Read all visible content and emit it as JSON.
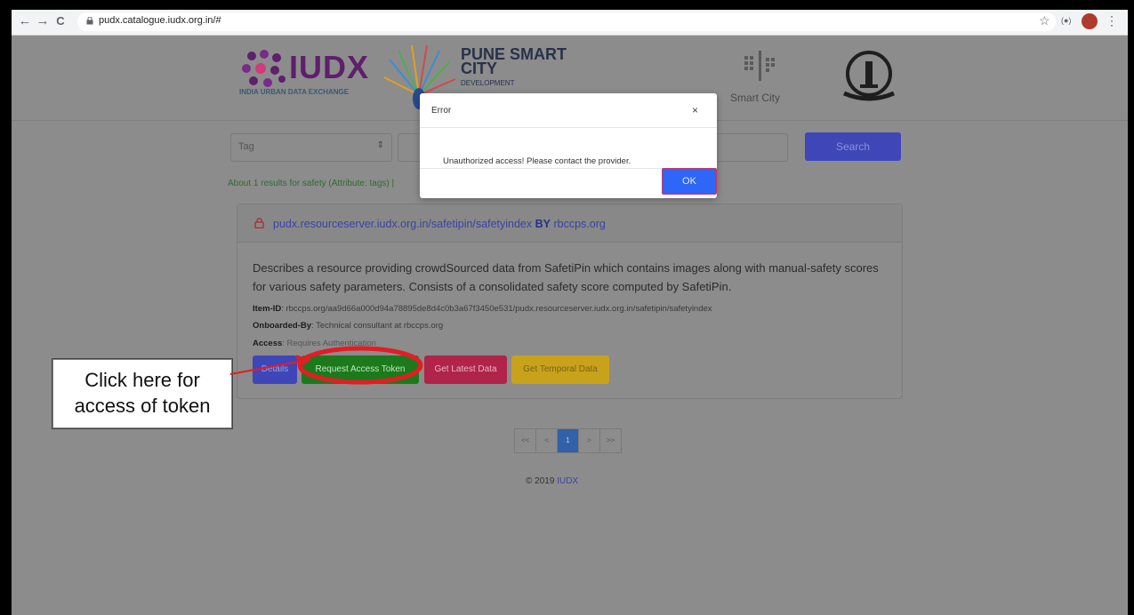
{
  "browser": {
    "url": "pudx.catalogue.iudx.org.in/#",
    "back_glyph": "←",
    "forward_glyph": "→",
    "reload_glyph": "C",
    "star_glyph": "☆",
    "ext_label": "(●)",
    "menu_glyph": "⋮"
  },
  "logos": {
    "iudx": "IUDX",
    "iudx_sub": "INDIA URBAN DATA EXCHANGE",
    "pune_title": "PUNE SMART CITY",
    "pune_sub": "DEVELOPMENT",
    "smart_city": "Smart City"
  },
  "search": {
    "tag_label": "Tag",
    "select_arrow": "⇕",
    "button": "Search"
  },
  "results_text": "About 1 results for safety (Attribute: tags) |",
  "card": {
    "title_url": "pudx.resourceserver.iudx.org.in/safetipin/safetyindex",
    "title_by": "BY",
    "title_provider": "rbccps.org",
    "description": "Describes a resource providing crowdSourced data from SafetiPin which contains images along with manual-safety scores for various safety parameters. Consists of a consolidated safety score computed by SafetiPin.",
    "item_id_label": "Item-ID",
    "item_id_value": ": rbccps.org/aa9d66a000d94a78895de8d4c0b3a67f3450e531/pudx.resourceserver.iudx.org.in/safetipin/safetyindex",
    "onboarded_label": "Onboarded-By",
    "onboarded_value": ": Technical consultant at rbccps.org",
    "access_label": "Access",
    "access_value": ": Requires Authentication",
    "buttons": {
      "details": "Details",
      "request": "Request Access Token",
      "latest": "Get Latest Data",
      "temporal": "Get Temporal Data"
    }
  },
  "pagination": [
    "<<",
    "<",
    "1",
    ">",
    ">>"
  ],
  "footer": {
    "copyright": "© 2019",
    "link": "IUDX"
  },
  "modal": {
    "title": "Error",
    "close": "×",
    "message": "Unauthorized access! Please contact the provider.",
    "ok": "OK"
  },
  "annotation": {
    "line1": "Click here for",
    "line2": "access of token"
  },
  "colors": {
    "overlay_gray": "#8c8c8c",
    "highlight_red": "#e21d24",
    "primary_blue": "#2e66f7"
  }
}
